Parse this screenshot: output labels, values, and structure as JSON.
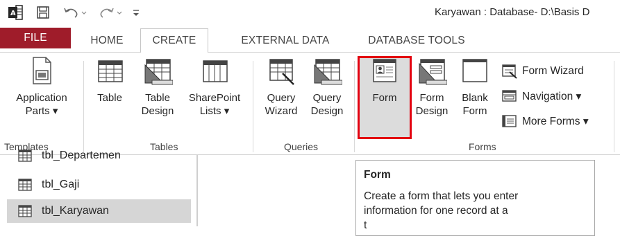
{
  "window": {
    "title": "Karyawan : Database- D:\\Basis D"
  },
  "qat": {
    "app_icon": "access-icon",
    "save_icon": "save-icon",
    "undo_icon": "undo-icon",
    "redo_icon": "redo-icon",
    "customize_icon": "customize-qat-icon"
  },
  "tabs": [
    {
      "label": "FILE"
    },
    {
      "label": "HOME"
    },
    {
      "label": "CREATE"
    },
    {
      "label": "EXTERNAL DATA"
    },
    {
      "label": "DATABASE TOOLS"
    }
  ],
  "ribbon": {
    "templates": {
      "app_parts_line1": "Application",
      "app_parts_line2": "Parts ▾",
      "group": "Templates"
    },
    "tables": {
      "table": "Table",
      "table_design_1": "Table",
      "table_design_2": "Design",
      "sharepoint_1": "SharePoint",
      "sharepoint_2": "Lists ▾",
      "group": "Tables"
    },
    "queries": {
      "wizard_1": "Query",
      "wizard_2": "Wizard",
      "design_1": "Query",
      "design_2": "Design",
      "group": "Queries"
    },
    "forms": {
      "form": "Form",
      "form_design_1": "Form",
      "form_design_2": "Design",
      "blank_1": "Blank",
      "blank_2": "Form",
      "form_wizard": "Form Wizard",
      "navigation": "Navigation ▾",
      "more_forms": "More Forms ▾",
      "group": "Forms"
    }
  },
  "nav": {
    "items": [
      {
        "label": "tbl_Departemen"
      },
      {
        "label": "tbl_Gaji"
      },
      {
        "label": "tbl_Karyawan"
      }
    ]
  },
  "tooltip": {
    "title": "Form",
    "body_line1": "Create a form that lets you enter",
    "body_line2": "information for one record at a",
    "body_line3": "t"
  },
  "colors": {
    "file_tab": "#9f1c2a",
    "highlight": "#e3000f"
  }
}
